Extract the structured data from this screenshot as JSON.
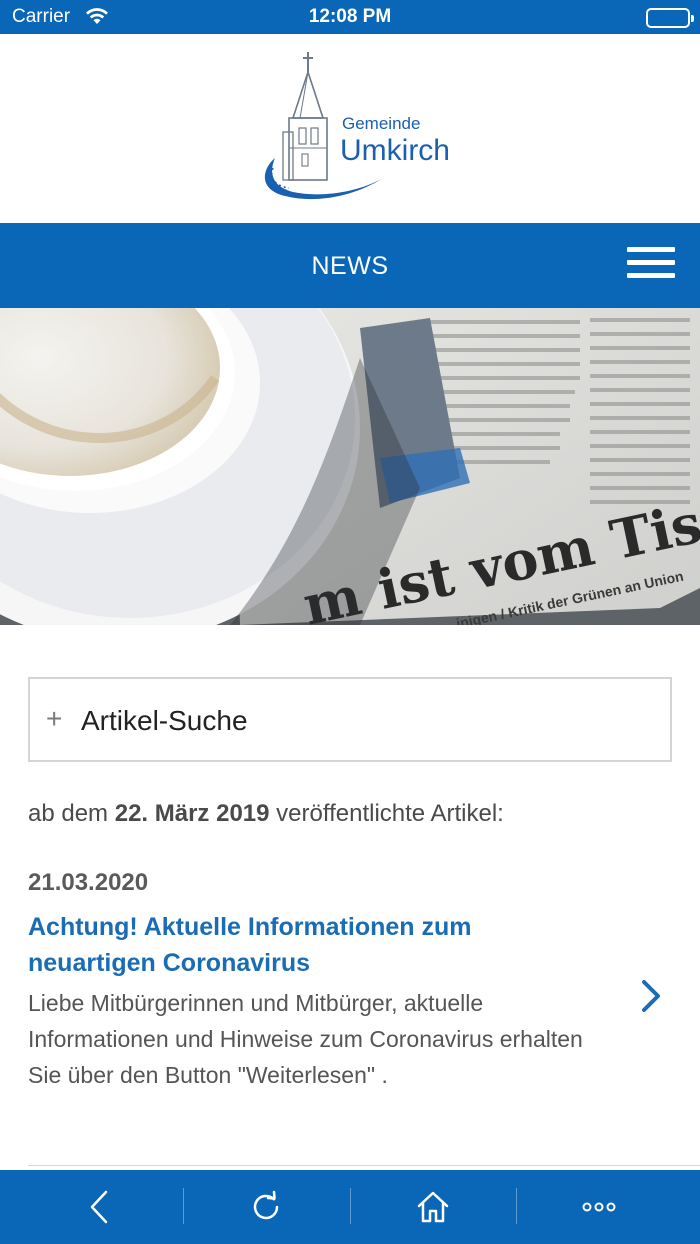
{
  "status_bar": {
    "carrier": "Carrier",
    "time": "12:08 PM"
  },
  "header": {
    "logo_small": "Gemeinde",
    "logo_big": "Umkirch",
    "logo_icon": "church-tower-logo"
  },
  "nav": {
    "title": "NEWS",
    "menu_icon": "hamburger-menu-icon"
  },
  "hero": {
    "image": "coffee-cup-and-newspaper-photo",
    "headline_fragment": "m ist vom Tisch",
    "subline_fragment": "inigen / Kritik der Grünen an Union"
  },
  "search": {
    "icon": "plus-icon",
    "label": "Artikel-Suche"
  },
  "listing": {
    "prefix": "ab dem ",
    "date": "22. März 2019",
    "suffix": " veröffentlichte Artikel:"
  },
  "articles": [
    {
      "date": "21.03.2020",
      "title": "Achtung! Aktuelle Informationen zum neuartigen Coronavirus",
      "body": "Liebe Mitbürgerinnen und Mitbürger, aktuelle Informationen und Hinweise zum Coronavirus erhalten Sie über den Button \"Weiterlesen\" ."
    }
  ],
  "bottom_bar": {
    "items": [
      "back-icon",
      "reload-icon",
      "home-icon",
      "more-icon"
    ]
  },
  "colors": {
    "brand_blue": "#0a66b7",
    "link_blue": "#1a6cb5"
  }
}
